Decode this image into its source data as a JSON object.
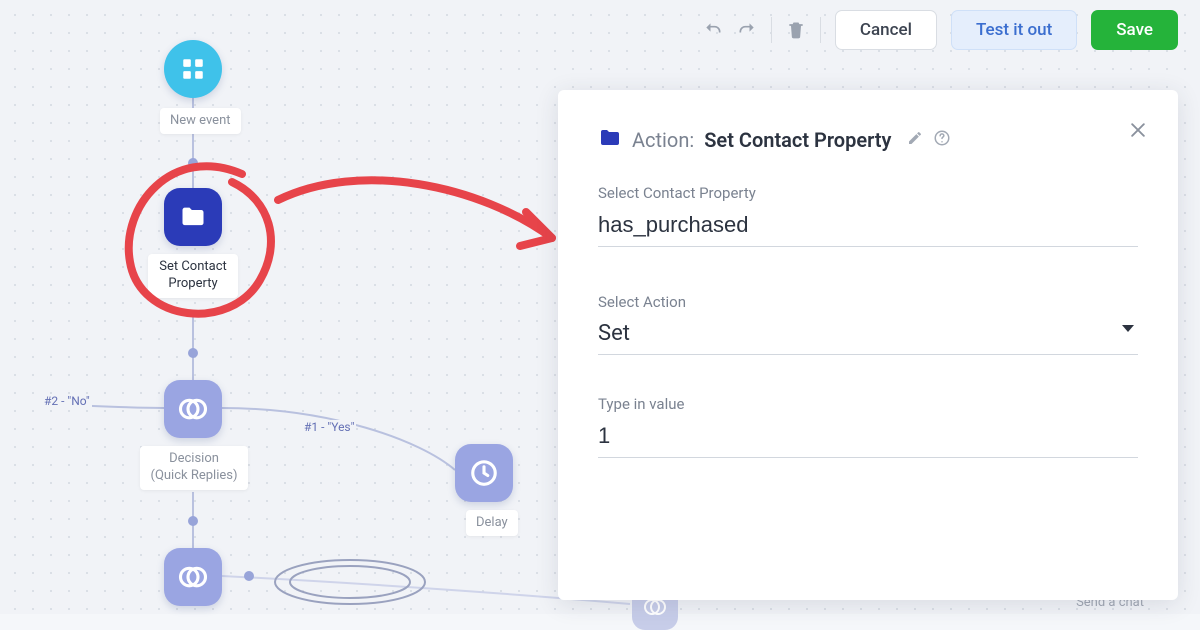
{
  "toolbar": {
    "cancel_label": "Cancel",
    "test_label": "Test it out",
    "save_label": "Save"
  },
  "panel": {
    "title_prefix": "Action:",
    "title_name": "Set Contact Property",
    "field1_label": "Select Contact Property",
    "field1_value": "has_purchased",
    "field2_label": "Select Action",
    "field2_value": "Set",
    "field3_label": "Type in value",
    "field3_value": "1"
  },
  "nodes": {
    "new_event": "New event",
    "set_contact": "Set Contact Property",
    "decision": "Decision (Quick Replies)",
    "delay": "Delay"
  },
  "edges": {
    "no": "#2 - \"No\"",
    "yes": "#1 - \"Yes\""
  },
  "footer": {
    "send_chat": "Send a chat"
  }
}
